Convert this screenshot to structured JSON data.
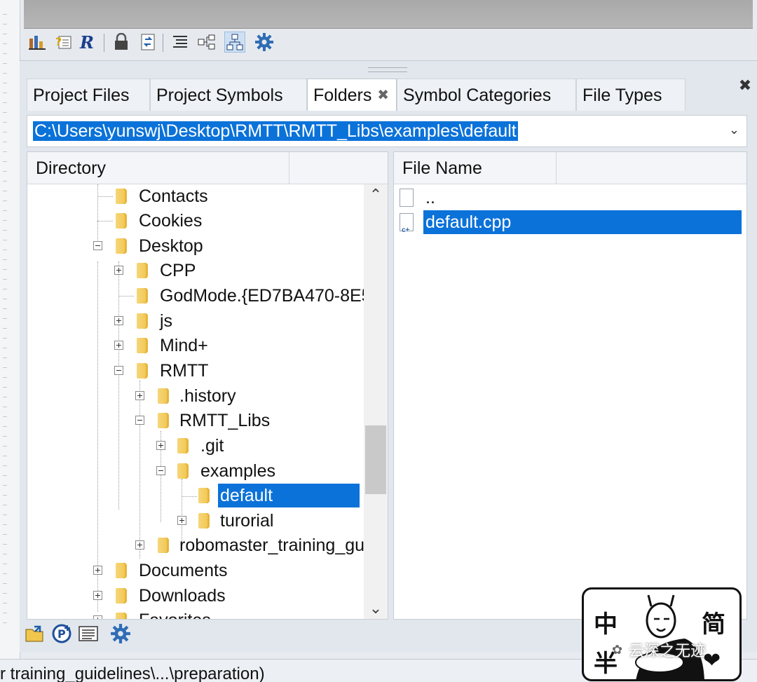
{
  "tabs": [
    {
      "label": "Project Files"
    },
    {
      "label": "Project Symbols"
    },
    {
      "label": "Folders",
      "close": "✖"
    },
    {
      "label": "Symbol Categories"
    },
    {
      "label": "File Types"
    }
  ],
  "panel_close": "✖",
  "path_combo": {
    "value": "C:\\Users\\yunswj\\Desktop\\RMTT\\RMTT_Libs\\examples\\default",
    "arrow": "⌄"
  },
  "dir_pane": {
    "header": "Directory",
    "scroll_up": "⌃",
    "scroll_down": "⌄"
  },
  "tree": [
    {
      "label": "Contacts"
    },
    {
      "label": "Cookies"
    },
    {
      "label": "Desktop"
    },
    {
      "label": "CPP"
    },
    {
      "label": "GodMode.{ED7BA470-8E5"
    },
    {
      "label": "js"
    },
    {
      "label": "Mind+"
    },
    {
      "label": "RMTT"
    },
    {
      "label": ".history"
    },
    {
      "label": "RMTT_Libs"
    },
    {
      "label": ".git"
    },
    {
      "label": "examples"
    },
    {
      "label": "default"
    },
    {
      "label": "turorial"
    },
    {
      "label": "robomaster_training_gu"
    },
    {
      "label": "Documents"
    },
    {
      "label": "Downloads"
    },
    {
      "label": "Favorites"
    }
  ],
  "file_pane": {
    "header": "File Name",
    "files": [
      {
        "name": ".."
      },
      {
        "name": "default.cpp"
      }
    ]
  },
  "status_text": "r training_guidelines\\...\\preparation)",
  "watermark": {
    "chars": [
      "中",
      "半",
      "简"
    ],
    "text": "云深之无迹"
  },
  "colors": {
    "selection": "#0b72d9",
    "panel_bg": "#e2e7ee",
    "folder": "#f0c64d"
  },
  "toolbar_icons": [
    "chart-icon",
    "help-icon",
    "r-icon",
    "lock-icon",
    "sync-icon",
    "list-icon",
    "tree-icon",
    "hierarchy-icon",
    "gear-icon"
  ],
  "bottom_icons": [
    "open-folder-icon",
    "project-icon",
    "browse-icon",
    "gear-icon"
  ]
}
